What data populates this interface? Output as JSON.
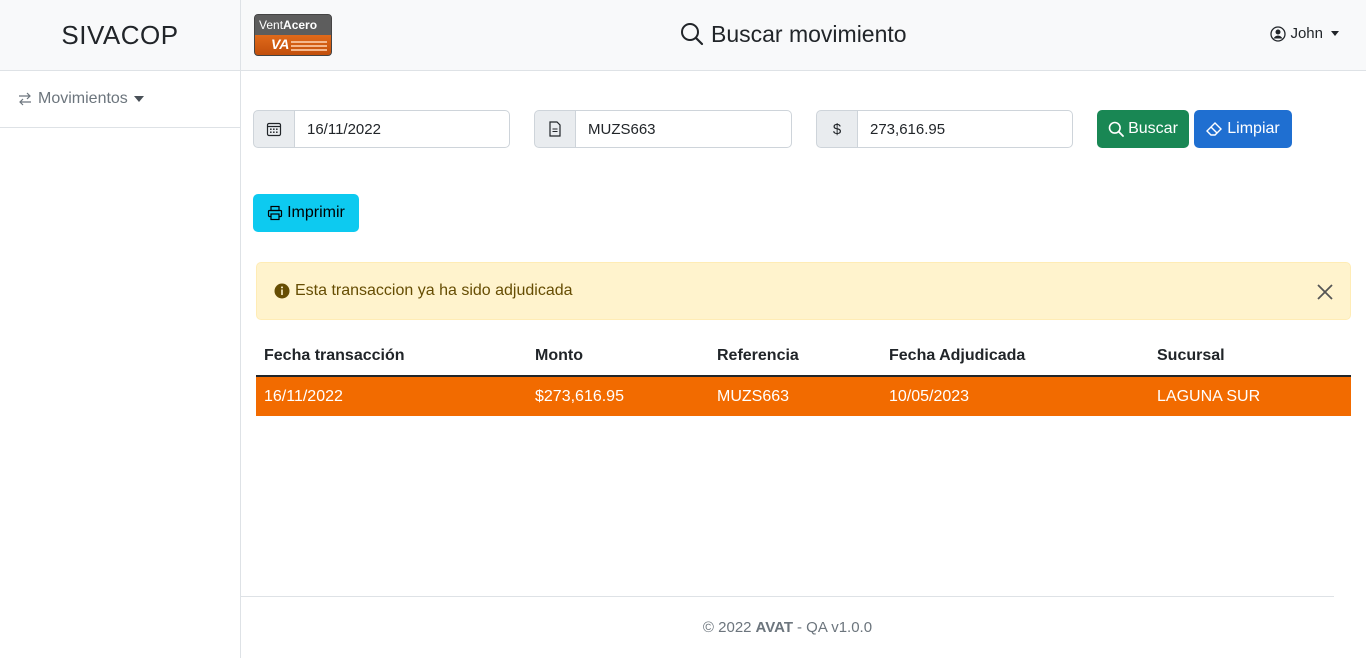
{
  "sidebar": {
    "brand": "SIVACOP",
    "items": [
      {
        "label": "Movimientos"
      }
    ]
  },
  "header": {
    "logo_text_light": "Vent",
    "logo_text_bold": "Acero",
    "logo_mark": "VA",
    "title": "Buscar movimiento",
    "user": "John"
  },
  "filters": {
    "date_value": "16/11/2022",
    "reference_value": "MUZS663",
    "amount_prefix": "$",
    "amount_value": "273,616.95",
    "search_label": "Buscar",
    "clear_label": "Limpiar",
    "print_label": "Imprimir"
  },
  "alert": {
    "message": "Esta transaccion ya ha sido adjudicada"
  },
  "table": {
    "columns": [
      "Fecha transacción",
      "Monto",
      "Referencia",
      "Fecha Adjudicada",
      "Sucursal"
    ],
    "rows": [
      [
        "16/11/2022",
        "$273,616.95",
        "MUZS663",
        "10/05/2023",
        "LAGUNA SUR"
      ]
    ]
  },
  "footer": {
    "prefix": "© 2022",
    "brand": "AVAT",
    "suffix": "- QA v1.0.0"
  },
  "colors": {
    "highlight_row": "#f26b00",
    "search_button": "#198754",
    "clear_button": "#1f6fd1",
    "print_button": "#0dcaf0",
    "alert_bg": "#fff3cd"
  }
}
